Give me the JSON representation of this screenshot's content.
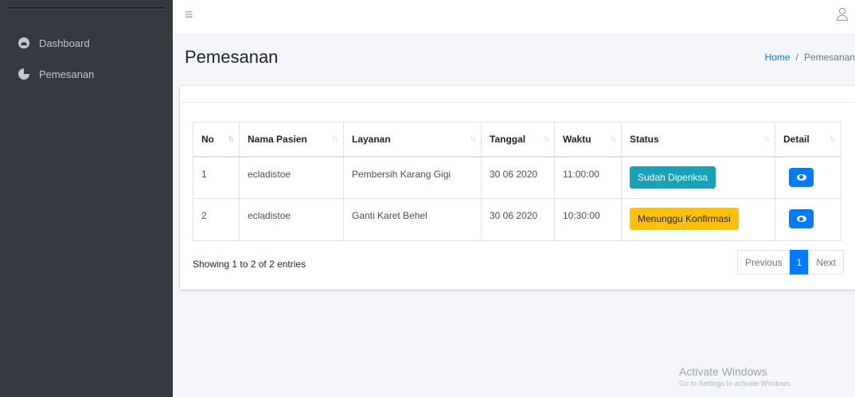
{
  "sidebar": {
    "items": [
      {
        "label": "Dashboard",
        "icon": "dashboard-gauge-icon"
      },
      {
        "label": "Pemesanan",
        "icon": "pie-chart-icon"
      }
    ]
  },
  "header": {
    "menu_icon": "hamburger-menu-icon",
    "user_icon": "user-icon"
  },
  "page": {
    "title": "Pemesanan",
    "breadcrumb": {
      "home": "Home",
      "separator": "/",
      "current": "Pemesanan"
    }
  },
  "table": {
    "columns": [
      "No",
      "Nama Pasien",
      "Layanan",
      "Tanggal",
      "Waktu",
      "Status",
      "Detail"
    ],
    "rows": [
      {
        "no": "1",
        "nama": "ecladistoe",
        "layanan": "Pembersih Karang Gigi",
        "tanggal": "30 06 2020",
        "waktu": "11:00:00",
        "status": "Sudah Diperiksa",
        "status_color": "#17a2b8"
      },
      {
        "no": "2",
        "nama": "ecladistoe",
        "layanan": "Ganti Karet Behel",
        "tanggal": "30 06 2020",
        "waktu": "10:30:00",
        "status": "Menunggu Konfirmasi",
        "status_color": "#ffc107"
      }
    ],
    "info": "Showing 1 to 2 of 2 entries",
    "pagination": {
      "previous": "Previous",
      "current": "1",
      "next": "Next"
    }
  },
  "watermark": {
    "line1": "Activate Windows",
    "line2": "Go to Settings to activate Windows."
  },
  "colors": {
    "sidebar_bg": "#343a40",
    "primary": "#007bff",
    "info": "#17a2b8",
    "warning": "#ffc107"
  }
}
